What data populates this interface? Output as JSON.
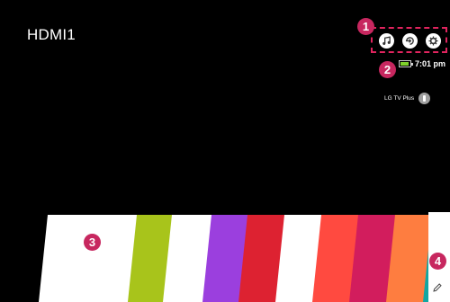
{
  "screen": {
    "input_name": "HDMI1"
  },
  "status": {
    "time": "7:01 pm",
    "battery_level": 0.9,
    "battery_color": "#7fd12b"
  },
  "account": {
    "label": "LG TV Plus"
  },
  "top_icons": [
    "music-icon",
    "input-icon",
    "settings-icon"
  ],
  "callouts": {
    "c1": "1",
    "c2": "2",
    "c3": "3",
    "c4": "4"
  },
  "launcher": {
    "tile_colors": [
      "#ffffff",
      "#a8c41b",
      "#ffffff",
      "#9b3fde",
      "#dd2231",
      "#ffffff",
      "#ff4a40",
      "#d21d5d",
      "#fe7d40",
      "#12a6a1"
    ]
  },
  "colors": {
    "callout": "#c7275f",
    "background": "#000000"
  }
}
